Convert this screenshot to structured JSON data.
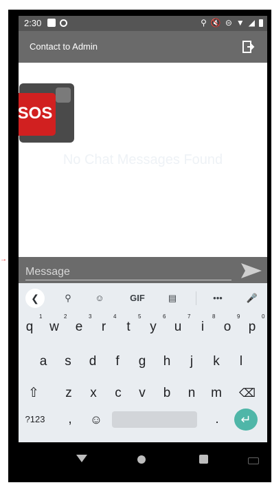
{
  "status": {
    "time": "2:30"
  },
  "appbar": {
    "title": "Contact to Admin"
  },
  "content": {
    "empty_message": "No Chat Messages Found"
  },
  "sos": {
    "label": "SOS"
  },
  "message_bar": {
    "placeholder": "Message"
  },
  "keyboard": {
    "toolbar": {
      "gif": "GIF",
      "more": "•••"
    },
    "row1": [
      "q",
      "w",
      "e",
      "r",
      "t",
      "y",
      "u",
      "i",
      "o",
      "p"
    ],
    "row1_hints": [
      "1",
      "2",
      "3",
      "4",
      "5",
      "6",
      "7",
      "8",
      "9",
      "0"
    ],
    "row2": [
      "a",
      "s",
      "d",
      "f",
      "g",
      "h",
      "j",
      "k",
      "l"
    ],
    "row3": [
      "z",
      "x",
      "c",
      "v",
      "b",
      "n",
      "m"
    ],
    "row4": {
      "numbers": "?123",
      "comma": ",",
      "period": "."
    }
  },
  "colors": {
    "statusbar": "#555555",
    "appbar": "#6a6a6a",
    "message_bar": "#6b6b6b",
    "keyboard": "#e9edf1",
    "enter": "#4fb6a8",
    "sos": "#d12020"
  }
}
